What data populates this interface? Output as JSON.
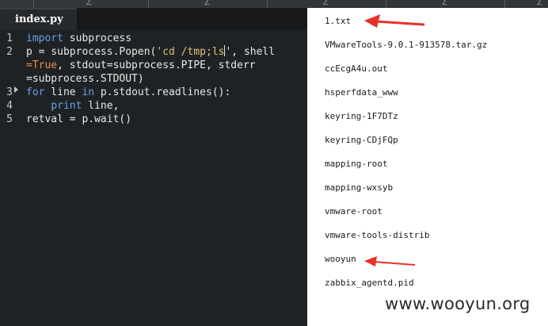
{
  "editor": {
    "tab_label": "index.py",
    "line_numbers": [
      "1",
      "2",
      "",
      "",
      "3",
      "4",
      "5"
    ],
    "lines": [
      {
        "tokens": [
          {
            "t": "kw",
            "v": "import"
          },
          {
            "t": "p",
            "v": " subprocess"
          }
        ]
      },
      {
        "tokens": [
          {
            "t": "p",
            "v": "p = subprocess.Popen("
          },
          {
            "t": "str",
            "v": "'cd /tmp;ls"
          }
        ]
      },
      {
        "tokens": [
          {
            "t": "cn",
            "v": "=True"
          },
          {
            "t": "p",
            "v": ", stdout=subprocess.PIPE, stderr"
          }
        ]
      },
      {
        "tokens": [
          {
            "t": "p",
            "v": "=subprocess.STDOUT)"
          }
        ]
      },
      {
        "tokens": [
          {
            "t": "kw",
            "v": "for"
          },
          {
            "t": "p",
            "v": " line "
          },
          {
            "t": "kw",
            "v": "in"
          },
          {
            "t": "p",
            "v": " p.stdout.readlines():"
          }
        ]
      },
      {
        "tokens": [
          {
            "t": "p",
            "v": "    "
          },
          {
            "t": "kw",
            "v": "print"
          },
          {
            "t": "p",
            "v": " line,"
          }
        ]
      },
      {
        "tokens": [
          {
            "t": "p",
            "v": "retval = p.wait()"
          }
        ]
      }
    ],
    "line2_tail": "', shell"
  },
  "listing": {
    "files": [
      "1.txt",
      "VMwareTools-9.0.1-913578.tar.gz",
      "ccEcgA4u.out",
      "hsperfdata_www",
      "keyring-1F7DTz",
      "keyring-CDjFQp",
      "mapping-root",
      "mapping-wxsyb",
      "vmware-root",
      "vmware-tools-distrib",
      "wooyun",
      "zabbix_agentd.pid"
    ],
    "arrow_color": "#e8312a"
  },
  "watermark": "www.wooyun.org"
}
